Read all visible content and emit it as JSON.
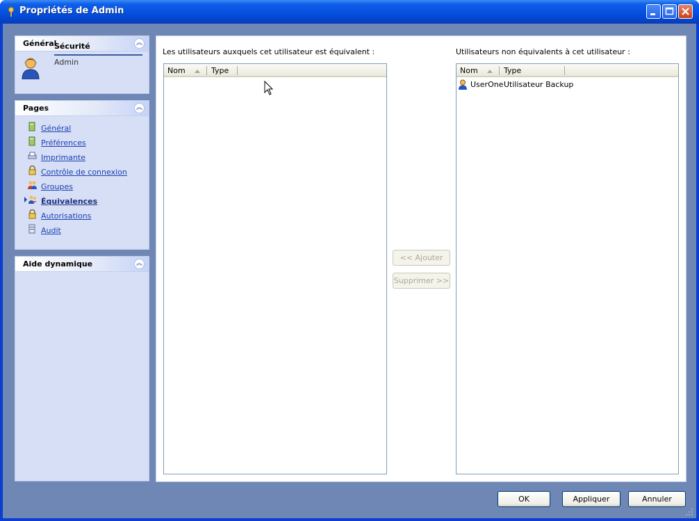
{
  "window": {
    "title": "Propriétés de Admin"
  },
  "sidebar": {
    "general": {
      "title": "Général",
      "section": "Sécurité",
      "user": "Admin"
    },
    "pages": {
      "title": "Pages",
      "items": [
        {
          "label": "Général",
          "icon": "document-icon",
          "active": false
        },
        {
          "label": "Préférences",
          "icon": "document-icon",
          "active": false
        },
        {
          "label": "Imprimante",
          "icon": "printer-icon",
          "active": false
        },
        {
          "label": "Contrôle de connexion",
          "icon": "lock-icon",
          "active": false
        },
        {
          "label": "Groupes",
          "icon": "group-icon",
          "active": false
        },
        {
          "label": "Équivalences",
          "icon": "equivalence-icon",
          "active": true
        },
        {
          "label": "Autorisations",
          "icon": "lock-icon",
          "active": false
        },
        {
          "label": "Audit",
          "icon": "audit-icon",
          "active": false
        }
      ]
    },
    "aide": {
      "title": "Aide dynamique"
    }
  },
  "main": {
    "left_label": "Les utilisateurs auxquels cet utilisateur est équivalent :",
    "right_label": "Utilisateurs non équivalents à cet utilisateur :",
    "columns": {
      "nom": "Nom",
      "type": "Type"
    },
    "left_rows": [],
    "right_rows": [
      {
        "nom": "UserOne",
        "type": "Utilisateur Backup"
      }
    ],
    "add_button": "<< Ajouter",
    "remove_button": "Supprimer >>"
  },
  "footer": {
    "ok": "OK",
    "apply": "Appliquer",
    "cancel": "Annuler"
  }
}
